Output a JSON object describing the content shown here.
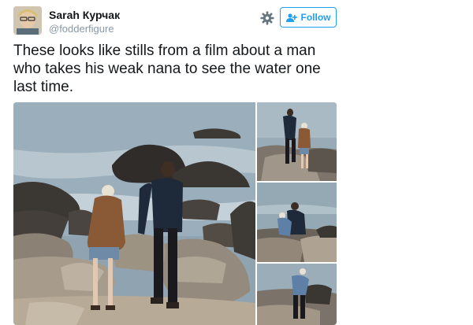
{
  "user": {
    "display_name": "Sarah Курчак",
    "handle": "@fodderfigure",
    "avatar_icon": "avatar-image"
  },
  "actions": {
    "settings_icon": "gear-icon",
    "follow_icon": "add-user-icon",
    "follow_label": "Follow",
    "accent_color": "#1da1f2"
  },
  "tweet": {
    "text_line1": "These looks like stills from a film about a man",
    "text_line2": "who takes his weak nana to see the water one",
    "text_line3": "last time."
  },
  "media": {
    "photos": [
      "main-photo",
      "thumbnail-1",
      "thumbnail-2",
      "thumbnail-3"
    ]
  }
}
